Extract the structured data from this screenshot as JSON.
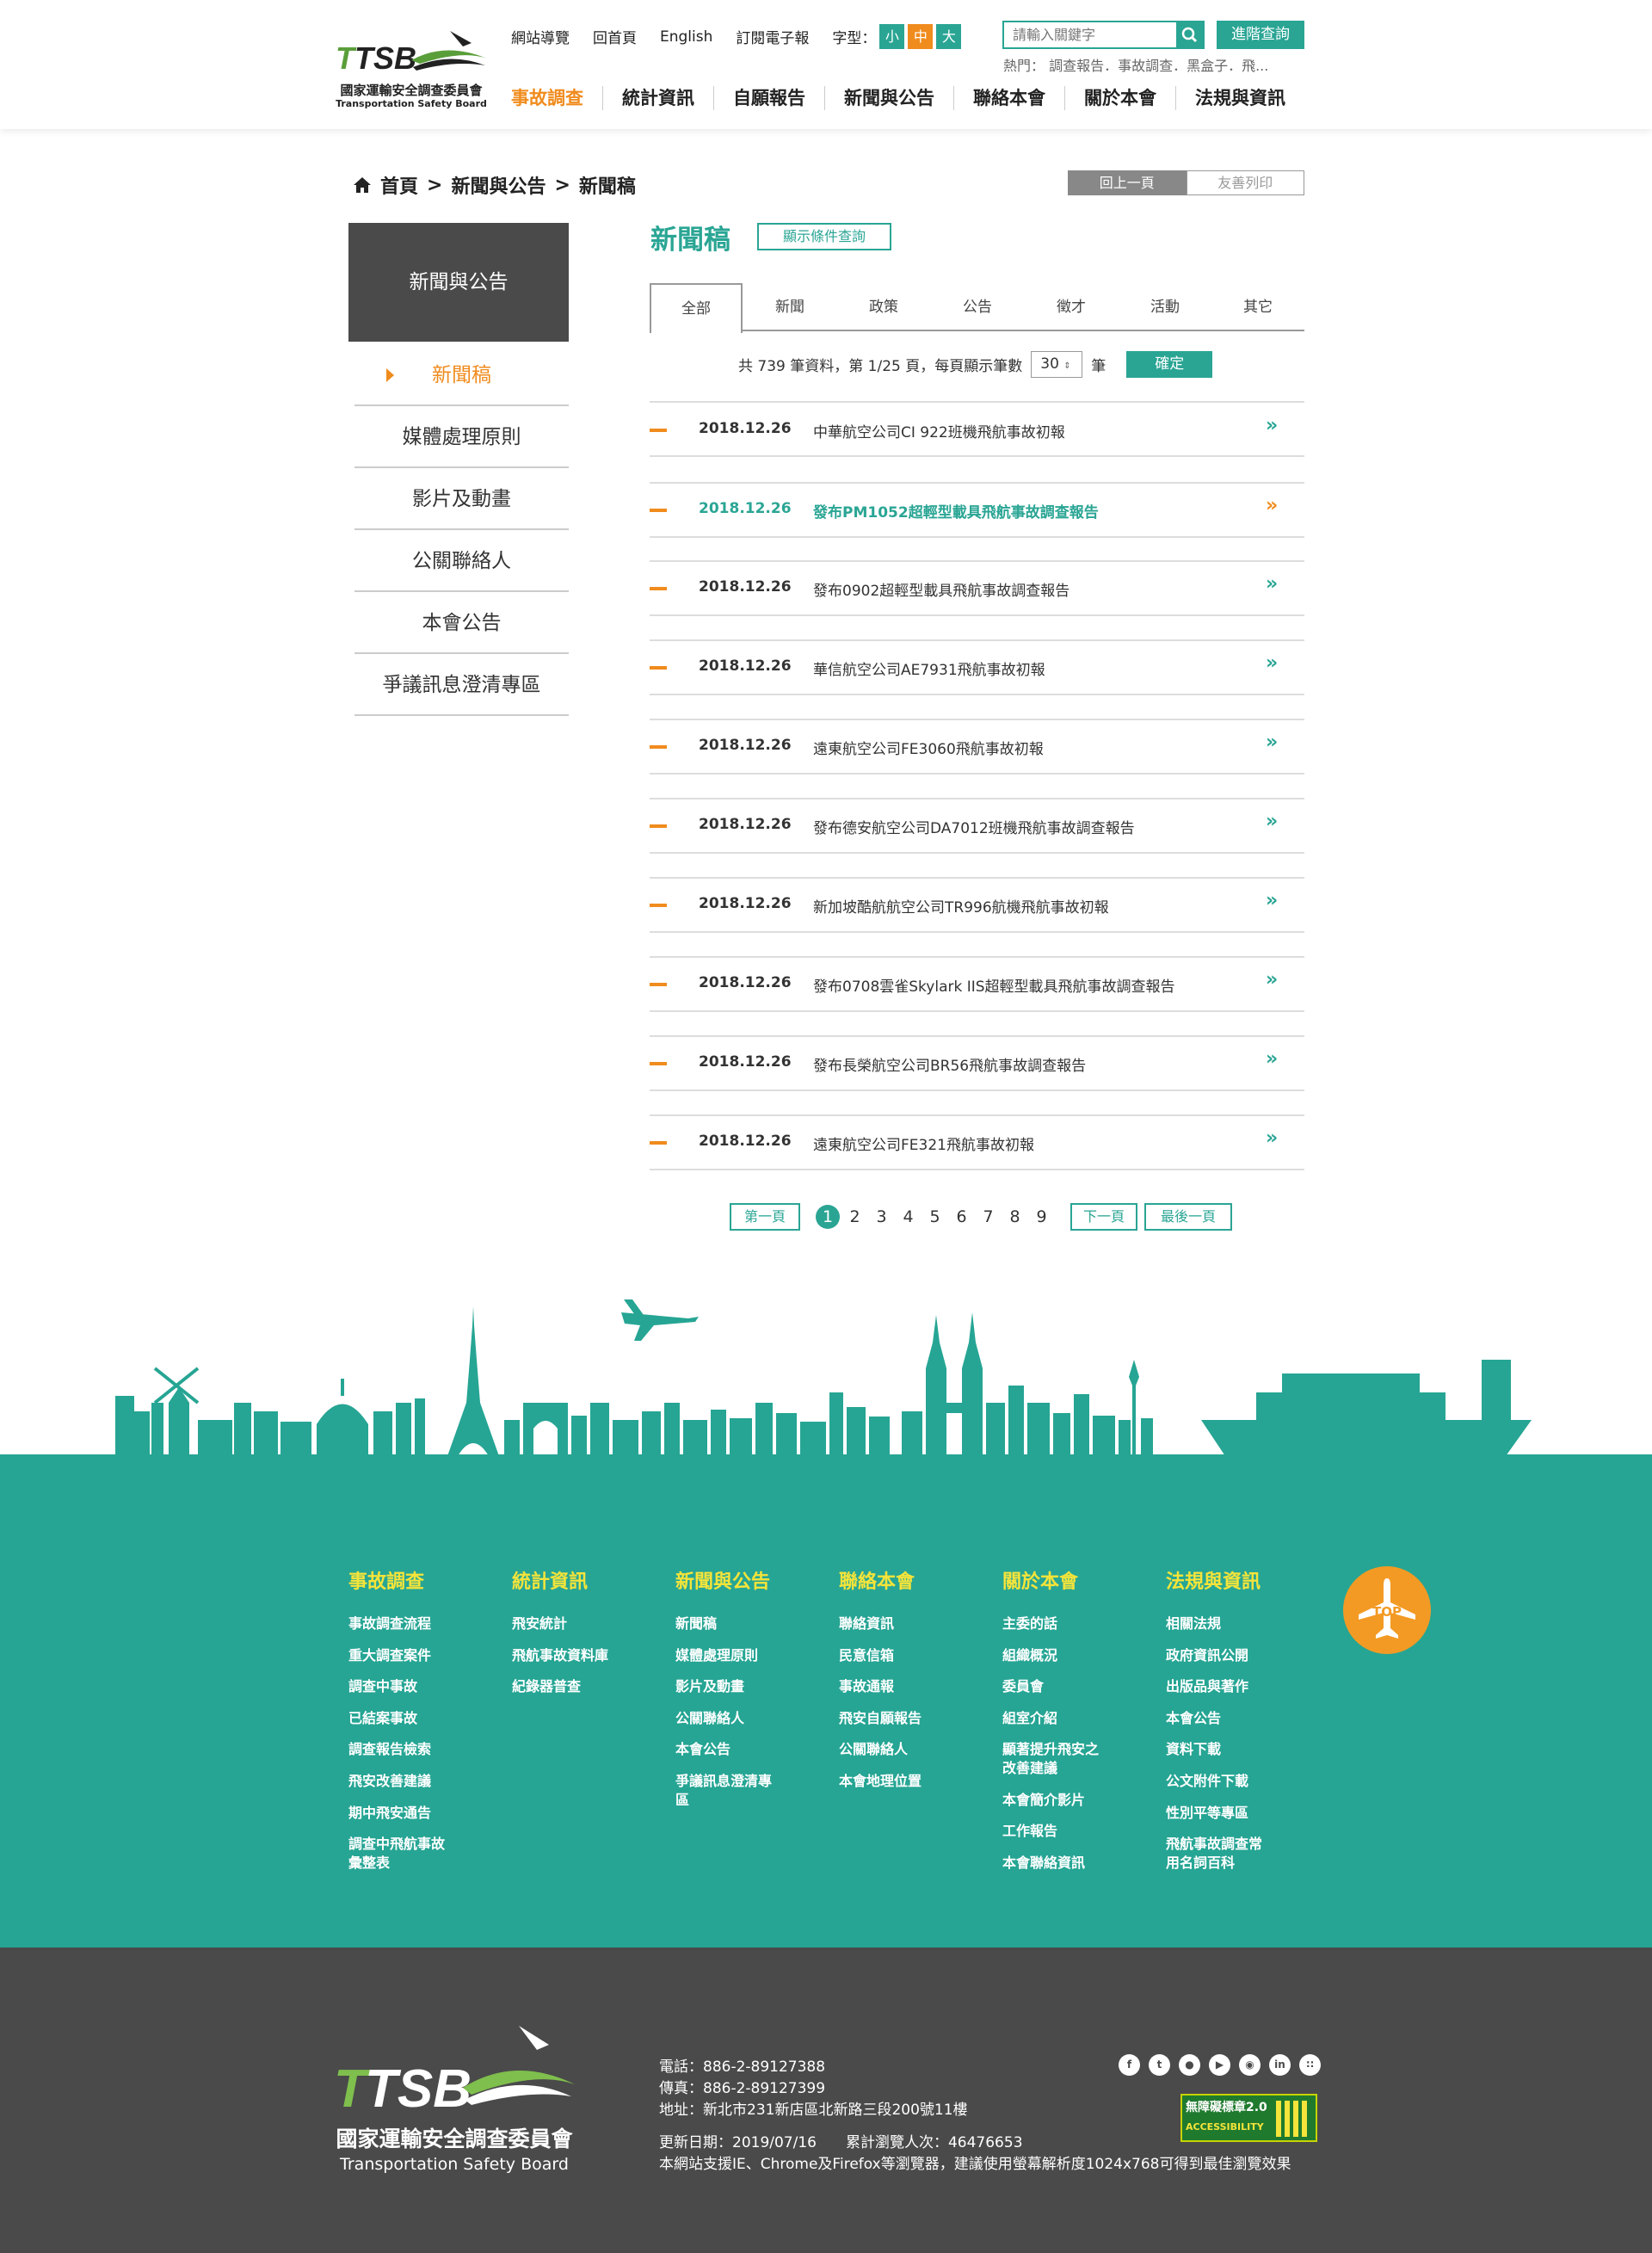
{
  "header": {
    "logo": {
      "mark": "TTSB",
      "name_zh": "國家運輸安全調查委員會",
      "name_en": "Transportation Safety Board"
    },
    "top_links": [
      "網站導覽",
      "回首頁",
      "English",
      "訂閱電子報"
    ],
    "font_size": {
      "label": "字型：",
      "options": [
        "小",
        "中",
        "大"
      ],
      "colors": [
        "#2aa594",
        "#f08b1d",
        "#2aa594"
      ]
    },
    "search": {
      "placeholder": "請輸入關鍵字",
      "advanced_label": "進階查詢"
    },
    "hot": "熱門： 調查報告．事故調查．黑盒子．飛...",
    "nav": [
      {
        "label": "事故調查",
        "active": true
      },
      {
        "label": "統計資訊"
      },
      {
        "label": "自願報告"
      },
      {
        "label": "新聞與公告"
      },
      {
        "label": "聯絡本會"
      },
      {
        "label": "關於本會"
      },
      {
        "label": "法規與資訊"
      }
    ]
  },
  "breadcrumb": {
    "home": "首頁",
    "sep": ">",
    "level1": "新聞與公告",
    "level2": "新聞稿"
  },
  "page_actions": {
    "back": "回上一頁",
    "print": "友善列印"
  },
  "sidebar": {
    "title": "新聞與公告",
    "items": [
      "新聞稿",
      "媒體處理原則",
      "影片及動畫",
      "公關聯絡人",
      "本會公告",
      "爭議訊息澄清專區"
    ]
  },
  "main": {
    "title": "新聞稿",
    "condition_btn": "顯示條件查詢",
    "tabs": [
      "全部",
      "新聞",
      "政策",
      "公告",
      "徵才",
      "活動",
      "其它"
    ],
    "info": {
      "pre": "共 739 筆資料，第 1/25 頁，每頁顯示筆數",
      "per_page": "30",
      "unit": "筆",
      "confirm": "確定"
    },
    "rows": [
      {
        "date": "2018.12.26",
        "title": "中華航空公司CI 922班機飛航事故初報"
      },
      {
        "date": "2018.12.26",
        "title": "發布PM1052超輕型載具飛航事故調查報告"
      },
      {
        "date": "2018.12.26",
        "title": "發布0902超輕型載具飛航事故調查報告"
      },
      {
        "date": "2018.12.26",
        "title": "華信航空公司AE7931飛航事故初報"
      },
      {
        "date": "2018.12.26",
        "title": "遠東航空公司FE3060飛航事故初報"
      },
      {
        "date": "2018.12.26",
        "title": "發布德安航空公司DA7012班機飛航事故調查報告"
      },
      {
        "date": "2018.12.26",
        "title": "新加坡酷航航空公司TR996航機飛航事故初報"
      },
      {
        "date": "2018.12.26",
        "title": "發布0708雲雀Skylark IIS超輕型載具飛航事故調查報告"
      },
      {
        "date": "2018.12.26",
        "title": "發布長榮航空公司BR56飛航事故調查報告"
      },
      {
        "date": "2018.12.26",
        "title": "遠東航空公司FE321飛航事故初報"
      }
    ],
    "highlight_row": 1,
    "pager": {
      "first": "第一頁",
      "pages": [
        "1",
        "2",
        "3",
        "4",
        "5",
        "6",
        "7",
        "8",
        "9"
      ],
      "current": "1",
      "next": "下一頁",
      "last": "最後一頁"
    }
  },
  "footer_links": [
    {
      "title": "事故調查",
      "items": [
        "事故調查流程",
        "重大調查案件",
        "調查中事故",
        "已結案事故",
        "調查報告檢索",
        "飛安改善建議",
        "期中飛安通告",
        "調查中飛航事故彙整表"
      ]
    },
    {
      "title": "統計資訊",
      "items": [
        "飛安統計",
        "飛航事故資料庫",
        "紀錄器普查"
      ]
    },
    {
      "title": "新聞與公告",
      "items": [
        "新聞稿",
        "媒體處理原則",
        "影片及動畫",
        "公關聯絡人",
        "本會公告",
        "爭議訊息澄清專區"
      ]
    },
    {
      "title": "聯絡本會",
      "items": [
        "聯絡資訊",
        "民意信箱",
        "事故通報",
        "飛安自願報告",
        "公關聯絡人",
        "本會地理位置"
      ]
    },
    {
      "title": "關於本會",
      "items": [
        "主委的話",
        "組織概況",
        "委員會",
        "組室介紹",
        "顯著提升飛安之改善建議",
        "本會簡介影片",
        "工作報告",
        "本會聯絡資訊"
      ]
    },
    {
      "title": "法規與資訊",
      "items": [
        "相關法規",
        "政府資訊公開",
        "出版品與著作",
        "本會公告",
        "資料下載",
        "公文附件下載",
        "性別平等專區",
        "飛航事故調查常用名詞百科"
      ]
    }
  ],
  "top_button": "TOP",
  "footer": {
    "logo": {
      "mark": "TTSB",
      "name_zh": "國家運輸安全調查委員會",
      "name_en": "Transportation Safety Board"
    },
    "tel": "電話：886-2-89127388",
    "fax": "傳真：886-2-89127399",
    "address": "地址：新北市231新店區北新路三段200號11樓",
    "updated": "更新日期：2019/07/16　　累計瀏覽人次：46476653",
    "browser": "本網站支援IE、Chrome及Firefox等瀏覽器，建議使用螢幕解析度1024x768可得到最佳瀏覽效果",
    "social": [
      "f",
      "t",
      "line",
      "yt",
      "ig",
      "in",
      "rss"
    ],
    "a11y_label": "無障礙標章2.0",
    "a11y_sub": "ACCESSIBILITY"
  },
  "colors": {
    "teal": "#2aa594",
    "orange": "#f08b1d",
    "dark": "#4a4a4a",
    "footer_green": "#26a594",
    "yellow": "#f5e43a"
  }
}
